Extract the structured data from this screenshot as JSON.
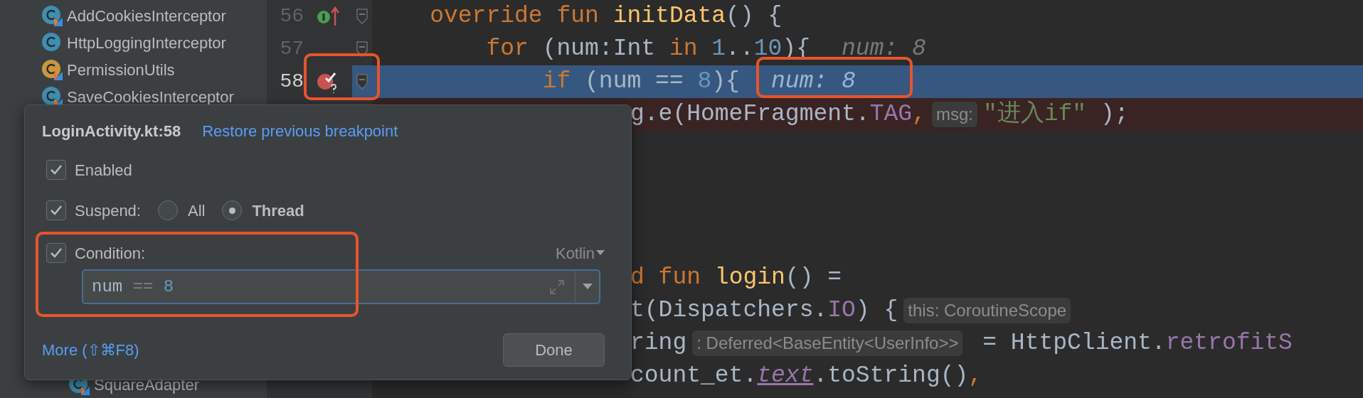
{
  "project_tree": {
    "items": [
      {
        "name": "AddCookiesInterceptor",
        "kind": "kotlin_class"
      },
      {
        "name": "HttpLoggingInterceptor",
        "kind": "java_class"
      },
      {
        "name": "PermissionUtils",
        "kind": "kotlin_object"
      },
      {
        "name": "SaveCookiesInterceptor",
        "kind": "kotlin_class"
      }
    ],
    "lower_items": [
      {
        "name": "SquareAdapter",
        "kind": "kotlin_class"
      }
    ]
  },
  "editor": {
    "lines": [
      {
        "kind": "code",
        "number": "56",
        "override_marker": true,
        "breakpoint": false,
        "current": false,
        "breakpoint_line": false,
        "tokens": [
          {
            "text": "    override",
            "kind": "keyword"
          },
          {
            "text": " fun",
            "kind": "keyword"
          },
          {
            "text": " initData",
            "kind": "function"
          },
          {
            "text": "() {",
            "kind": "plain"
          }
        ]
      },
      {
        "kind": "code",
        "number": "57",
        "override_marker": false,
        "breakpoint": false,
        "current": false,
        "breakpoint_line": false,
        "tokens": [
          {
            "text": "        for",
            "kind": "keyword"
          },
          {
            "text": " (num:Int ",
            "kind": "plain"
          },
          {
            "text": "in",
            "kind": "keyword"
          },
          {
            "text": " 1",
            "kind": "number"
          },
          {
            "text": "..",
            "kind": "plain"
          },
          {
            "text": "10",
            "kind": "number"
          },
          {
            "text": "){",
            "kind": "plain"
          }
        ],
        "value": "num: 8"
      },
      {
        "kind": "code",
        "number": "58",
        "override_marker": false,
        "breakpoint": true,
        "current": true,
        "breakpoint_line": false,
        "tokens": [
          {
            "text": "            if",
            "kind": "keyword"
          },
          {
            "text": " (num == ",
            "kind": "plain"
          },
          {
            "text": "8",
            "kind": "number"
          },
          {
            "text": "){",
            "kind": "plain"
          }
        ],
        "value": "num: 8"
      },
      {
        "kind": "partial",
        "current": false,
        "breakpoint_line": true,
        "tokens": [
          {
            "text": "g.e(HomeFragment.",
            "kind": "plain"
          },
          {
            "text": "TAG",
            "kind": "property"
          },
          {
            "text": ",",
            "kind": "keyword"
          },
          {
            "text": "msg:",
            "kind": "hint"
          },
          {
            "text": "\"进入if\"",
            "kind": "string"
          },
          {
            "text": " );",
            "kind": "plain"
          }
        ]
      },
      {
        "kind": "blank"
      },
      {
        "kind": "blank"
      },
      {
        "kind": "blank"
      },
      {
        "kind": "blank"
      },
      {
        "kind": "partial",
        "current": false,
        "breakpoint_line": false,
        "tokens": [
          {
            "text": "d",
            "kind": "keyword"
          },
          {
            "text": " fun",
            "kind": "keyword"
          },
          {
            "text": " login",
            "kind": "function"
          },
          {
            "text": "() =",
            "kind": "plain"
          }
        ]
      },
      {
        "kind": "partial",
        "current": false,
        "breakpoint_line": false,
        "tokens": [
          {
            "text": "t(Dispatchers.",
            "kind": "plain"
          },
          {
            "text": "IO",
            "kind": "property"
          },
          {
            "text": ") {",
            "kind": "plain"
          },
          {
            "text": "this: CoroutineScope",
            "kind": "hint"
          }
        ]
      },
      {
        "kind": "partial",
        "current": false,
        "breakpoint_line": false,
        "tokens": [
          {
            "text": "ring",
            "kind": "plain"
          },
          {
            "text": ": Deferred<BaseEntity<UserInfo>>",
            "kind": "hint"
          },
          {
            "text": " = HttpClient.",
            "kind": "plain"
          },
          {
            "text": "retrofitS",
            "kind": "property"
          }
        ]
      },
      {
        "kind": "partial",
        "current": false,
        "breakpoint_line": false,
        "tokens": [
          {
            "text": "count_et.",
            "kind": "plain"
          },
          {
            "text": "text",
            "kind": "synthetic"
          },
          {
            "text": ".toString()",
            "kind": "plain"
          },
          {
            "text": ",",
            "kind": "keyword"
          }
        ]
      }
    ]
  },
  "breakpoint_popup": {
    "title": "LoginActivity.kt:58",
    "restore_link": "Restore previous breakpoint",
    "enabled": {
      "label": "Enabled",
      "checked": true
    },
    "suspend": {
      "label": "Suspend:",
      "checked": true,
      "options": [
        {
          "label": "All",
          "selected": false
        },
        {
          "label": "Thread",
          "selected": true
        }
      ]
    },
    "condition": {
      "label": "Condition:",
      "checked": true,
      "language": "Kotlin",
      "tokens": [
        {
          "text": "num",
          "kind": "plain"
        },
        {
          "text": " == ",
          "kind": "operator"
        },
        {
          "text": "8",
          "kind": "number"
        }
      ]
    },
    "more_link": "More (⇧⌘F8)",
    "done_button": "Done"
  }
}
